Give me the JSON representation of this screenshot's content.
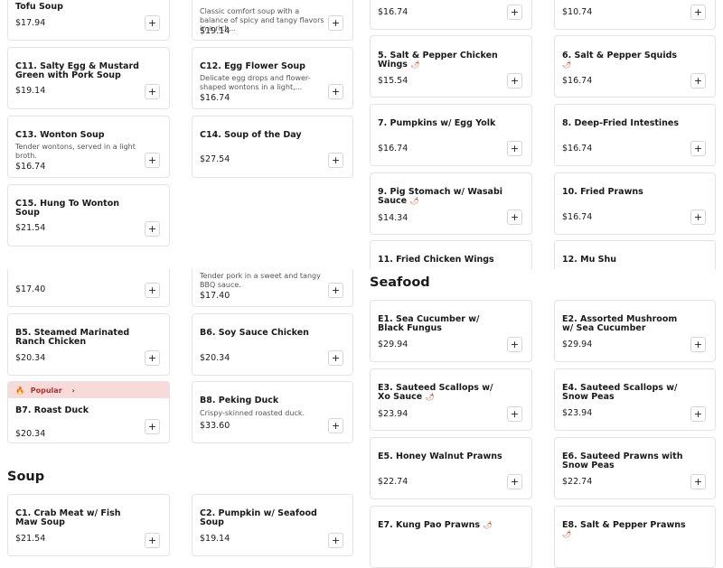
{
  "add_label": "+",
  "chili_glyph": "🌶",
  "sections": {
    "seafood": "Seafood",
    "soup": "Soup"
  },
  "popular_badge": {
    "icon": "fire-icon",
    "label": "Popular",
    "chevron": "›"
  },
  "items": {
    "tofu_soup": {
      "name": "Tofu Soup",
      "price": "$17.94"
    },
    "spicy_soup": {
      "desc": "Classic comfort soup with a balance of spicy and tangy flavors in a rich...",
      "price": "$19.14"
    },
    "c11": {
      "name": "C11. Salty Egg & Mustard Green with Pork Soup",
      "price": "$19.14"
    },
    "c12": {
      "name": "C12. Egg Flower Soup",
      "desc": "Delicate egg drops and flower-shaped wontons in a light,...",
      "price": "$16.74"
    },
    "c13": {
      "name": "C13. Wonton Soup",
      "desc": "Tender wontons, served in a light broth.",
      "price": "$16.74"
    },
    "c14": {
      "name": "C14. Soup of the Day",
      "price": "$27.54"
    },
    "c15": {
      "name": "C15. Hung To Wonton Soup",
      "price": "$21.54"
    },
    "top_a": {
      "price": "$16.74"
    },
    "top_b": {
      "price": "$10.74"
    },
    "n5": {
      "name": "5. Salt & Pepper Chicken Wings",
      "price": "$15.54"
    },
    "n6": {
      "name": "6. Salt & Pepper Squids",
      "price": "$16.74"
    },
    "n7": {
      "name": "7. Pumpkins w/ Egg Yolk",
      "price": "$16.74"
    },
    "n8": {
      "name": "8. Deep-Fried Intestines",
      "price": "$16.74"
    },
    "n9": {
      "name": "9. Pig Stomach w/ Wasabi Sauce",
      "price": "$14.34"
    },
    "n10": {
      "name": "10. Fried Prawns",
      "price": "$16.74"
    },
    "n11": {
      "name": "11. Fried Chicken Wings"
    },
    "n12": {
      "name": "12. Mu Shu"
    },
    "bbq_a": {
      "price": "$17.40"
    },
    "bbq_b": {
      "desc": "Tender pork in a sweet and tangy BBQ sauce.",
      "price": "$17.40"
    },
    "b5": {
      "name": "B5. Steamed Marinated Ranch Chicken",
      "price": "$20.34"
    },
    "b6": {
      "name": "B6. Soy Sauce Chicken",
      "price": "$20.34"
    },
    "b7": {
      "name": "B7. Roast Duck",
      "price": "$20.34"
    },
    "b8": {
      "name": "B8. Peking Duck",
      "desc": "Crispy-skinned roasted duck.",
      "price": "$33.60"
    },
    "c1": {
      "name": "C1. Crab Meat w/ Fish Maw Soup",
      "price": "$21.54"
    },
    "c2": {
      "name": "C2. Pumpkin w/ Seafood Soup",
      "price": "$19.14"
    },
    "e1": {
      "name": "E1. Sea Cucumber w/ Black Fungus",
      "price": "$29.94"
    },
    "e2": {
      "name": "E2. Assorted Mushroom w/ Sea Cucumber",
      "price": "$29.94"
    },
    "e3": {
      "name": "E3. Sauteed Scallops w/ Xo Sauce",
      "price": "$23.94"
    },
    "e4": {
      "name": "E4. Sauteed Scallops w/ Snow Peas",
      "price": "$23.94"
    },
    "e5": {
      "name": "E5. Honey Walnut Prawns",
      "price": "$22.74"
    },
    "e6": {
      "name": "E6. Sauteed Prawns with Snow Peas",
      "price": "$22.74"
    },
    "e7": {
      "name": "E7. Kung Pao Prawns"
    },
    "e8": {
      "name": "E8. Salt & Pepper Prawns"
    }
  }
}
